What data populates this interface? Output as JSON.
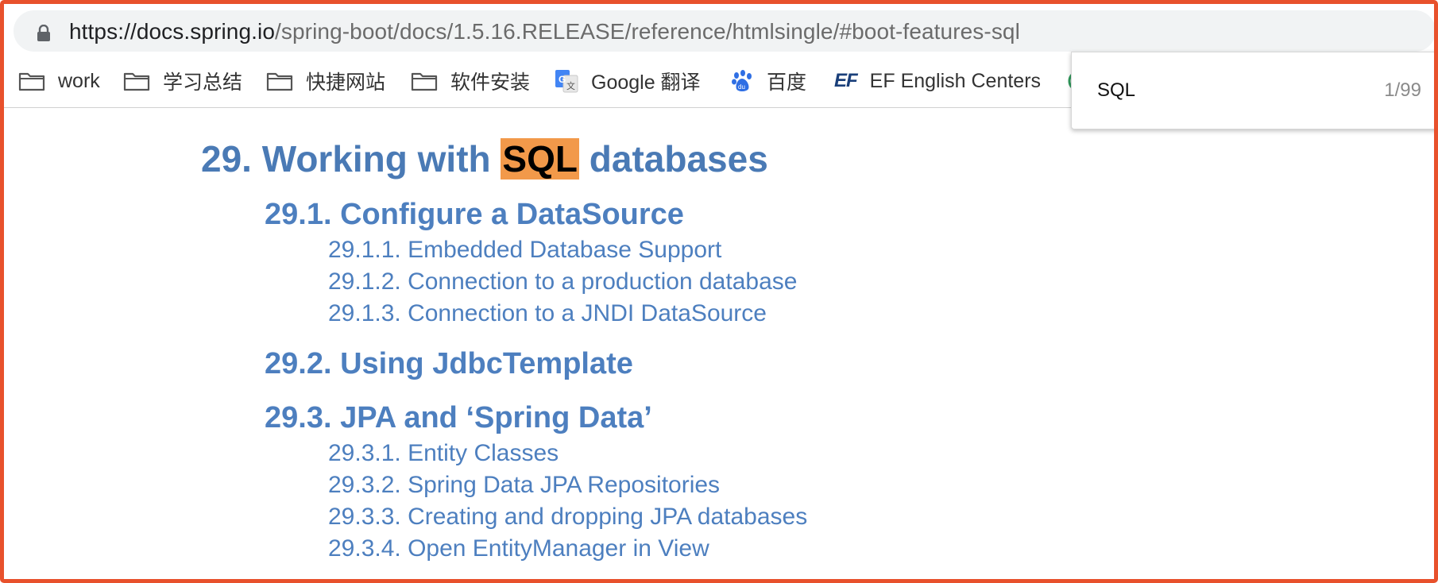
{
  "browser": {
    "url_host": "https://docs.spring.io",
    "url_path": "/spring-boot/docs/1.5.16.RELEASE/reference/htmlsingle/#boot-features-sql",
    "bookmarks": [
      {
        "label": "work",
        "icon": "folder-icon"
      },
      {
        "label": "学习总结",
        "icon": "folder-icon"
      },
      {
        "label": "快捷网站",
        "icon": "folder-icon"
      },
      {
        "label": "软件安装",
        "icon": "folder-icon"
      },
      {
        "label": "Google 翻译",
        "icon": "google-translate-icon"
      },
      {
        "label": "百度",
        "icon": "baidu-paw-icon"
      },
      {
        "label": "EF English Centers",
        "icon": "ef-logo-icon"
      }
    ]
  },
  "find": {
    "query": "SQL",
    "count": "1/99"
  },
  "doc": {
    "h1_prefix": "29. Working with ",
    "h1_highlight": "SQL",
    "h1_suffix": " databases",
    "sections": [
      {
        "title": "29.1. Configure a DataSource",
        "items": [
          "29.1.1. Embedded Database Support",
          "29.1.2. Connection to a production database",
          "29.1.3. Connection to a JNDI DataSource"
        ]
      },
      {
        "title": "29.2. Using JdbcTemplate",
        "items": []
      },
      {
        "title": "29.3. JPA and ‘Spring Data’",
        "items": [
          "29.3.1. Entity Classes",
          "29.3.2. Spring Data JPA Repositories",
          "29.3.3. Creating and dropping JPA databases",
          "29.3.4. Open EntityManager in View"
        ]
      }
    ]
  },
  "colors": {
    "frame_border": "#e8512c",
    "link": "#4d7fbf",
    "find_highlight": "#f2994a"
  }
}
